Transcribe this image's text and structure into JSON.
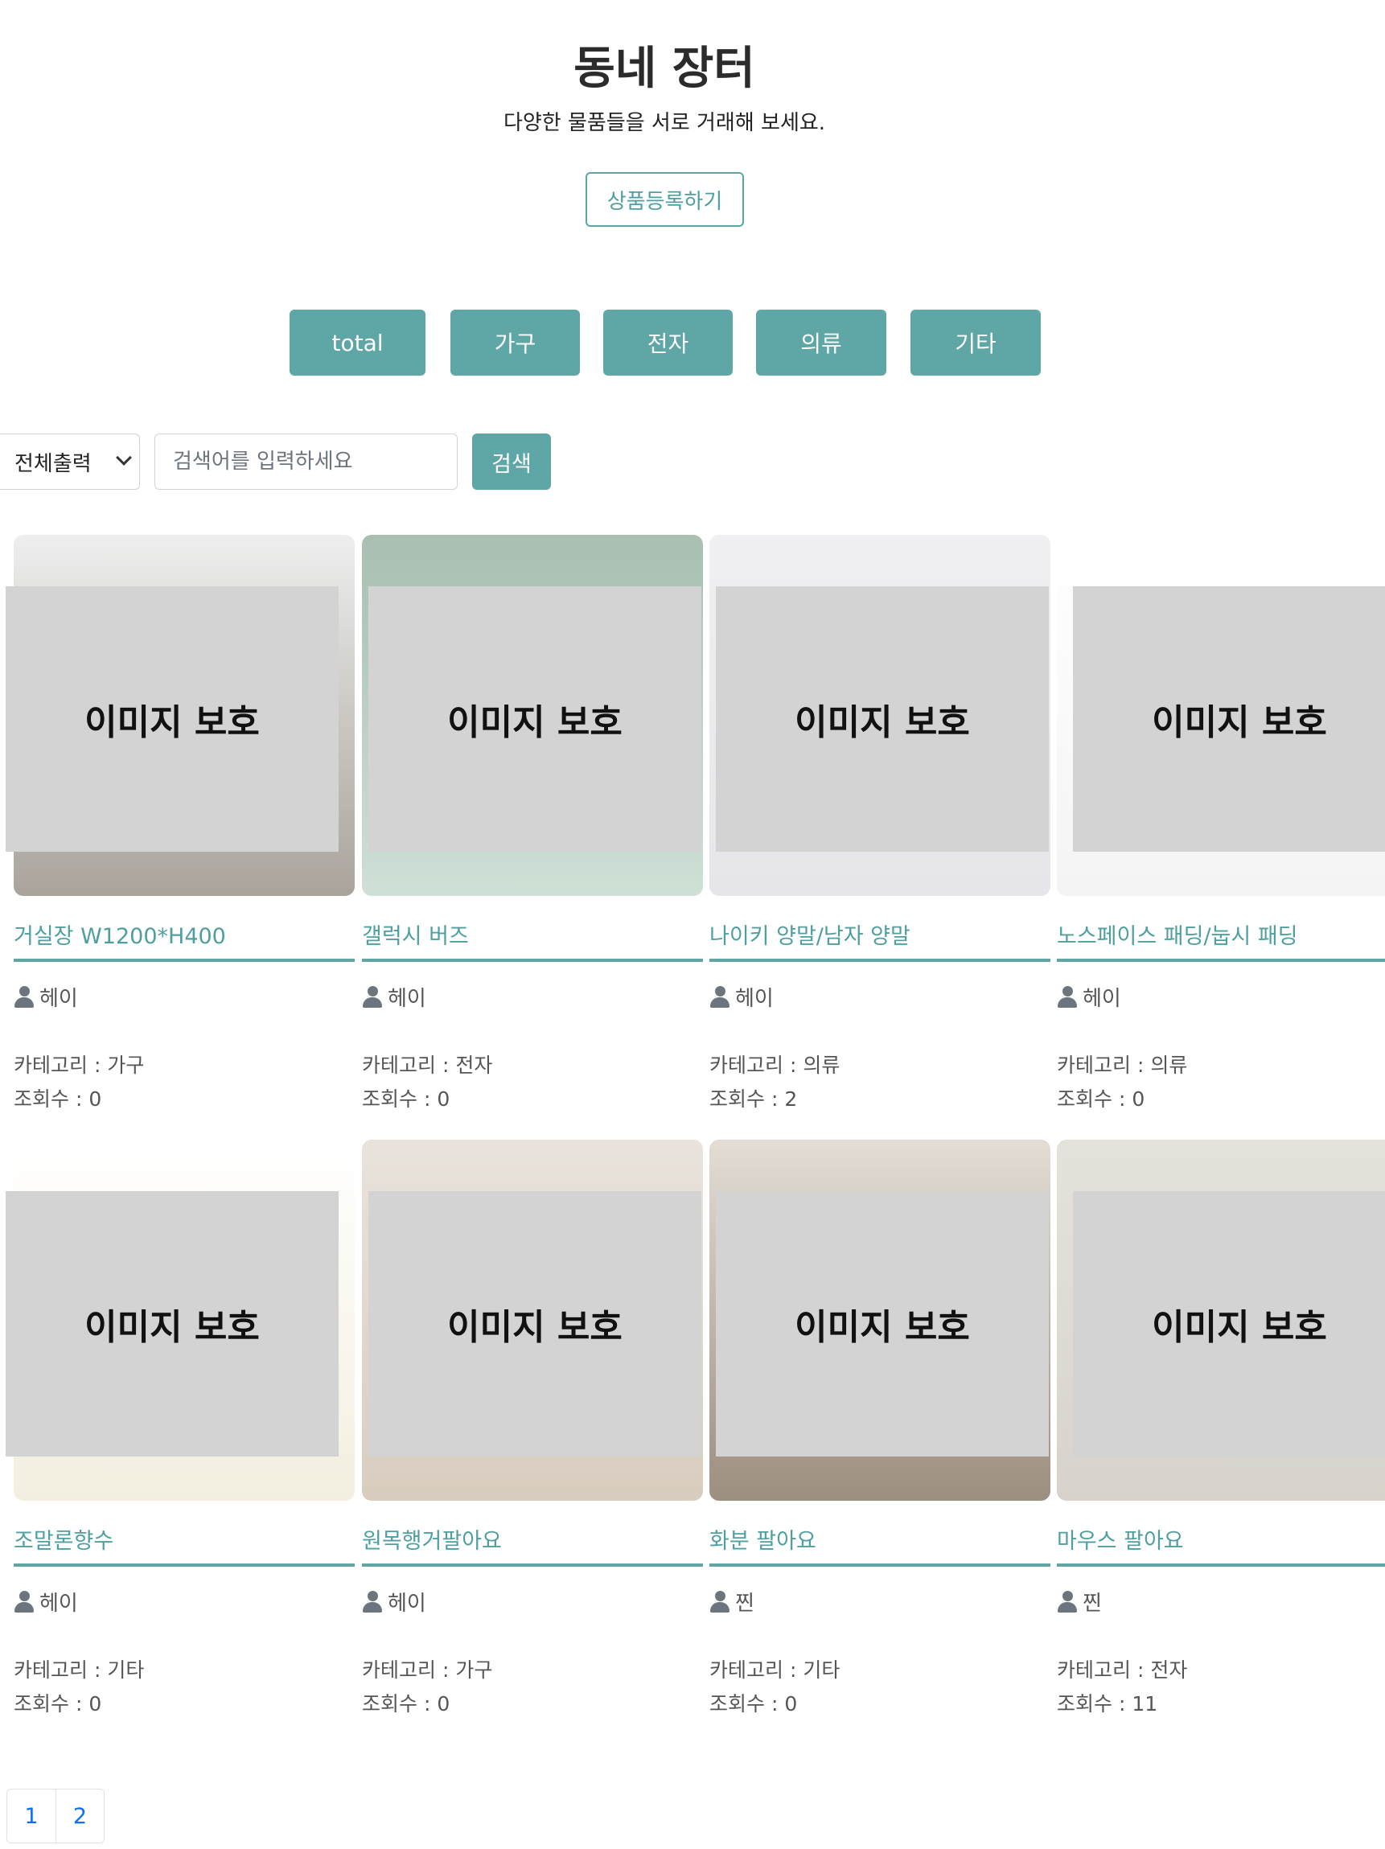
{
  "header": {
    "title": "동네 장터",
    "subtitle": "다양한 물품들을 서로 거래해 보세요.",
    "register_label": "상품등록하기"
  },
  "categories": [
    "total",
    "가구",
    "전자",
    "의류",
    "기타"
  ],
  "search": {
    "filter_selected": "전체출력",
    "placeholder": "검색어를 입력하세요",
    "value": "",
    "button_label": "검색"
  },
  "image_overlay_label": "이미지 보호",
  "products": [
    {
      "title": "거실장 W1200*H400",
      "user": "헤이",
      "category": "카테고리 : 가구",
      "views": "조회수 : 0",
      "img_colors": [
        "#eeeeee",
        "#a9a39b"
      ]
    },
    {
      "title": "갤럭시 버즈",
      "user": "헤이",
      "category": "카테고리 : 전자",
      "views": "조회수 : 0",
      "img_colors": [
        "#a8bfb2",
        "#cfe0d6"
      ]
    },
    {
      "title": "나이키 양말/남자 양말",
      "user": "헤이",
      "category": "카테고리 : 의류",
      "views": "조회수 : 2",
      "img_colors": [
        "#f0f0f2",
        "#e6e6ea"
      ]
    },
    {
      "title": "노스페이스 패딩/눕시 패딩",
      "user": "헤이",
      "category": "카테고리 : 의류",
      "views": "조회수 : 0",
      "img_colors": [
        "#ffffff",
        "#f4f4f4"
      ]
    },
    {
      "title": "조말론향수",
      "user": "헤이",
      "category": "카테고리 : 기타",
      "views": "조회수 : 0",
      "img_colors": [
        "#ffffff",
        "#f3efe0"
      ]
    },
    {
      "title": "원목행거팔아요",
      "user": "헤이",
      "category": "카테고리 : 가구",
      "views": "조회수 : 0",
      "img_colors": [
        "#e8e3dc",
        "#d8cdbf"
      ]
    },
    {
      "title": "화분 팔아요",
      "user": "찐",
      "category": "카테고리 : 기타",
      "views": "조회수 : 0",
      "img_colors": [
        "#e3ddd4",
        "#9c8e80"
      ]
    },
    {
      "title": "마우스 팔아요",
      "user": "찐",
      "category": "카테고리 : 전자",
      "views": "조회수 : 11",
      "img_colors": [
        "#e5e2dc",
        "#d7d3cc"
      ]
    }
  ],
  "pagination": [
    "1",
    "2"
  ]
}
